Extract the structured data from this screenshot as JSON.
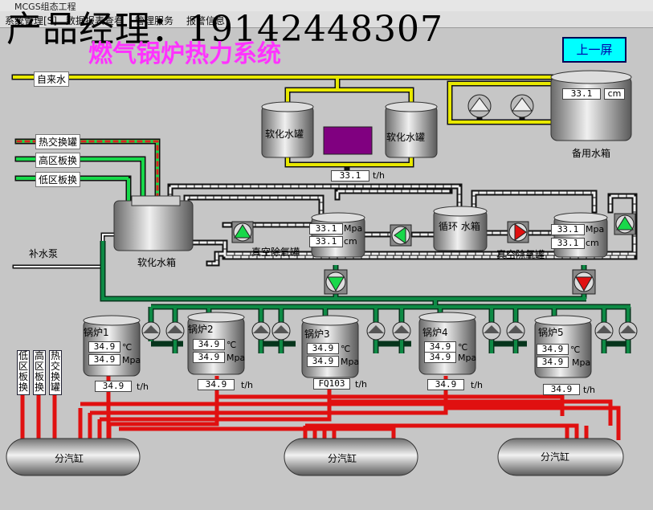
{
  "window": {
    "title": "MCGS组态工程"
  },
  "menu": [
    "系统管理[S]",
    "数据报表查看",
    "管理服务",
    "报警信息"
  ],
  "watermark": "产品经理：19142448307",
  "title": "燃气锅炉热力系统",
  "nav_button": "上一屏",
  "labels": {
    "tap_water": "自来水",
    "heat_exchange_tank": "热交换罐",
    "high_zone_plate": "高区板换",
    "low_zone_plate": "低区板换",
    "makeup_pump": "补水泵",
    "soft_tank_left": "软化水罐",
    "soft_tank_right": "软化水罐",
    "soft_water_box": "软化水箱",
    "standby_box": "备用水箱",
    "circ_box": "循环 水箱",
    "deaerator_left": "真空除氧罐",
    "deaerator_right": "真空除氧罐",
    "header": "分汽缸"
  },
  "vertical_labels": [
    "低区板换",
    "高区板换",
    "热交换罐"
  ],
  "units": {
    "cm": "cm",
    "flow": "t/h",
    "temp": "℃",
    "pressure": "Mpa"
  },
  "standby_level": "33.1",
  "softener_flow": "33.1",
  "deaerator_left": {
    "pressure": "33.1",
    "level": "33.1"
  },
  "deaerator_right": {
    "pressure": "33.1",
    "level": "33.1"
  },
  "boilers": [
    {
      "name": "锅炉1",
      "temp": "34.9",
      "pressure": "34.9",
      "flow": "34.9"
    },
    {
      "name": "锅炉2",
      "temp": "34.9",
      "pressure": "34.9",
      "flow": "34.9"
    },
    {
      "name": "锅炉3",
      "temp": "34.9",
      "pressure": "34.9",
      "flow": "FQ103"
    },
    {
      "name": "锅炉4",
      "temp": "34.9",
      "pressure": "34.9",
      "flow": "34.9"
    },
    {
      "name": "锅炉5",
      "temp": "34.9",
      "pressure": "34.9",
      "flow": "34.9"
    }
  ],
  "colors": {
    "title": "#ff33ff",
    "button_bg": "#00ffff",
    "pipe_green": "#007a3d",
    "pipe_yellow": "#e8e800",
    "pipe_red": "#e01010",
    "pump_active": "#18d84a",
    "pump_alarm": "#e01010"
  }
}
